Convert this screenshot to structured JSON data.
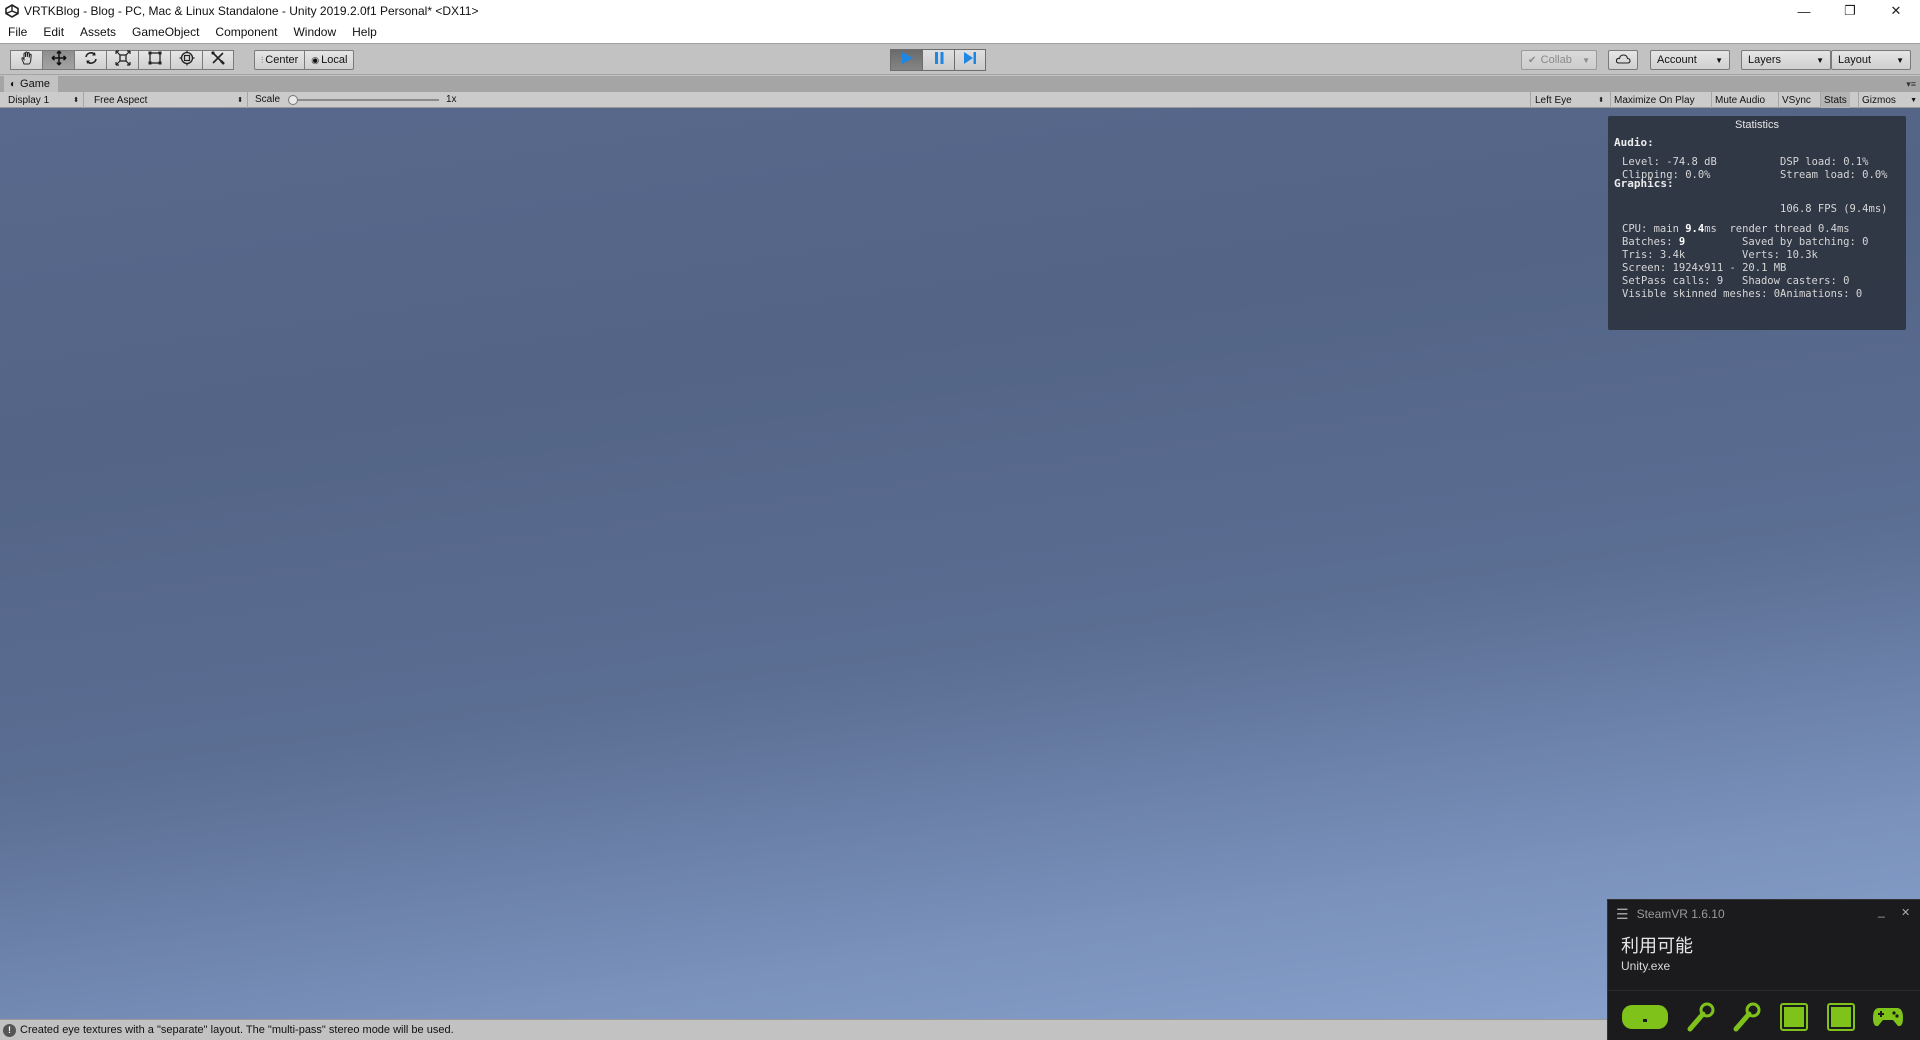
{
  "window": {
    "title": "VRTKBlog - Blog - PC, Mac & Linux Standalone - Unity 2019.2.0f1 Personal* <DX11>",
    "minimize_glyph": "—",
    "maximize_glyph": "❐",
    "close_glyph": "✕"
  },
  "menu": [
    "File",
    "Edit",
    "Assets",
    "GameObject",
    "Component",
    "Window",
    "Help"
  ],
  "toolbar": {
    "tools": [
      "hand-tool-icon",
      "move-tool-icon",
      "rotate-tool-icon",
      "scale-tool-icon",
      "rect-tool-icon",
      "transform-tool-icon",
      "custom-tool-icon"
    ],
    "pivot_mode": "Center",
    "pivot_rotation": "Local",
    "play_state": "playing",
    "collab_label": "Collab",
    "account_label": "Account",
    "layers_label": "Layers",
    "layout_label": "Layout",
    "play_color": "#1f86e6"
  },
  "game_tab": {
    "label": "Game"
  },
  "game_toolbar": {
    "display": "Display 1",
    "aspect": "Free Aspect",
    "scale_label": "Scale",
    "scale_value": "1x",
    "scale_fraction": 0.0,
    "eye": "Left Eye",
    "toggles": [
      "Maximize On Play",
      "Mute Audio",
      "VSync",
      "Stats",
      "Gizmos"
    ]
  },
  "statistics": {
    "title": "Statistics",
    "audio_heading": "Audio:",
    "level": "Level: -74.8 dB",
    "dsp_load": "DSP load: 0.1%",
    "clipping": "Clipping: 0.0%",
    "stream_load": "Stream load: 0.0%",
    "graphics_heading": "Graphics:",
    "fps": "106.8 FPS (9.4ms)",
    "cpu_prefix": "CPU: main ",
    "cpu_main": "9.4",
    "cpu_suffix": "ms  render thread 0.4ms",
    "batches_prefix": "Batches: ",
    "batches": "9",
    "saved_by_batching": "Saved by batching: 0",
    "tris": "Tris: 3.4k",
    "verts": "Verts: 10.3k",
    "screen": "Screen: 1924x911 - 20.1 MB",
    "setpass": "SetPass calls: 9",
    "shadow_casters": "Shadow casters: 0",
    "skinned_meshes": "Visible skinned meshes: 0",
    "animations": "Animations: 0"
  },
  "status_bar": {
    "icon_glyph": "!",
    "message": "Created eye textures with a \"separate\" layout.  The \"multi-pass\" stereo mode will be used."
  },
  "steamvr": {
    "title": "SteamVR 1.6.10",
    "status": "利用可能",
    "app": "Unity.exe",
    "minimize_glyph": "_",
    "close_glyph": "✕",
    "devices": [
      "headset-icon",
      "controller-left-icon",
      "controller-right-icon",
      "base-station-1-icon",
      "base-station-2-icon",
      "gamepad-icon"
    ],
    "device_color": "#7ec21a"
  }
}
